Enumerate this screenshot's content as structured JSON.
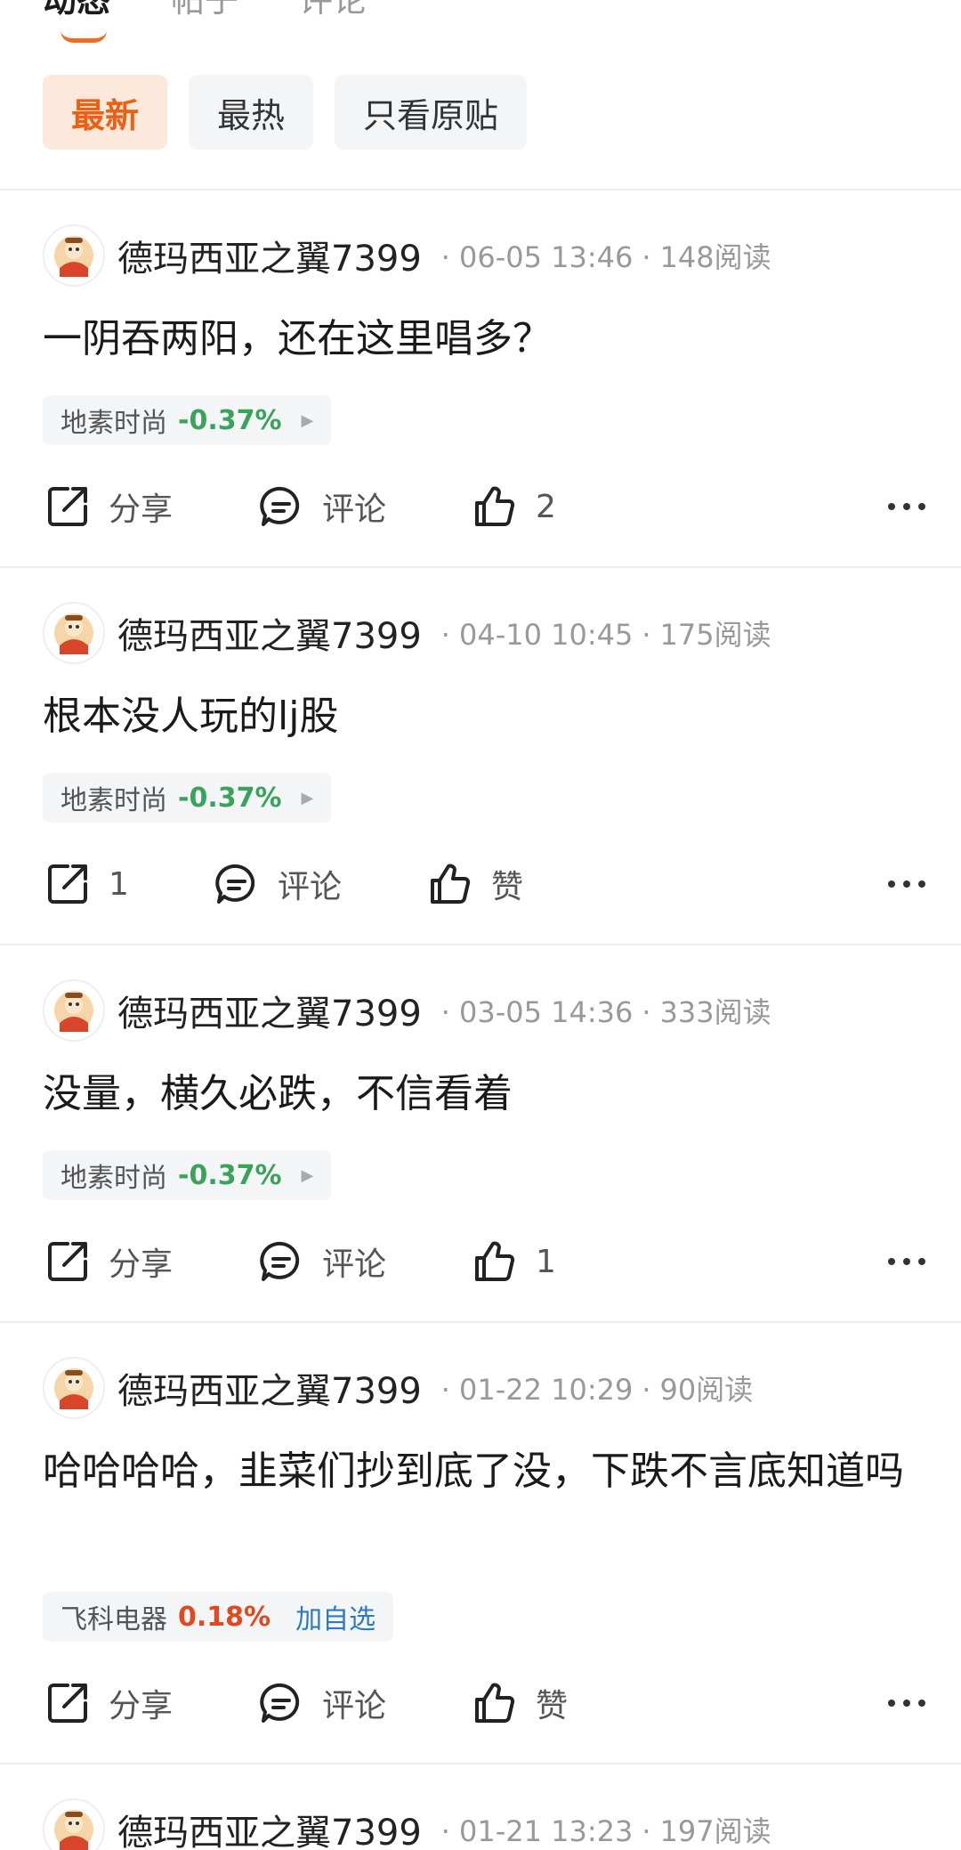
{
  "top_tabs": [
    {
      "label": "动态",
      "active": true
    },
    {
      "label": "帖子",
      "active": false
    },
    {
      "label": "评论",
      "active": false
    }
  ],
  "filters": [
    {
      "label": "最新",
      "active": true
    },
    {
      "label": "最热",
      "active": false
    },
    {
      "label": "只看原贴",
      "active": false
    }
  ],
  "posts": [
    {
      "username": "德玛西亚之翼7399",
      "time": "06-05 13:46",
      "reads": "148阅读",
      "text": "一阴吞两阳，还在这里唱多？",
      "stock": {
        "name": "地素时尚",
        "change": "-0.37%"
      },
      "share": "分享",
      "comment": "评论",
      "like": "2"
    },
    {
      "username": "德玛西亚之翼7399",
      "time": "04-10 10:45",
      "reads": "175阅读",
      "text": "根本没人玩的lj股",
      "stock": {
        "name": "地素时尚",
        "change": "-0.37%"
      },
      "share": "1",
      "comment": "评论",
      "like": "赞"
    },
    {
      "username": "德玛西亚之翼7399",
      "time": "03-05 14:36",
      "reads": "333阅读",
      "text": "没量，横久必跌，不信看着",
      "stock": {
        "name": "地素时尚",
        "change": "-0.37%"
      },
      "share": "分享",
      "comment": "评论",
      "like": "1"
    },
    {
      "username": "德玛西亚之翼7399",
      "time": "01-22 10:29",
      "reads": "90阅读",
      "text": "哈哈哈哈，韭菜们抄到底了没，下跌不言底知道吗",
      "stock": {
        "name": "飞科电器",
        "change": "0.18%",
        "add": "加自选"
      },
      "share": "分享",
      "comment": "评论",
      "like": "赞"
    },
    {
      "username": "德玛西亚之翼7399",
      "time": "01-21 13:23",
      "reads": "197阅读"
    }
  ],
  "colors": {
    "accent": "#ec6014",
    "down": "#3aa25a",
    "up": "#e0481f",
    "link": "#2a7bbf"
  }
}
